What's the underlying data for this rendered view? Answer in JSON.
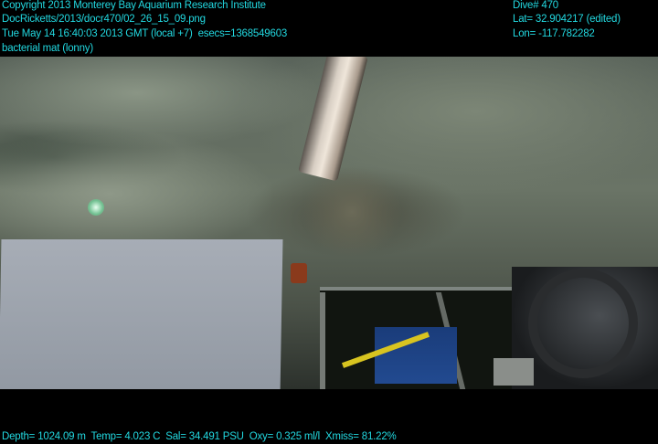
{
  "header": {
    "copyright": "Copyright 2013 Monterey Bay Aquarium Research Institute",
    "file_path": "DocRicketts/2013/docr470/02_26_15_09.png",
    "timestamp": "Tue May 14 16:40:03 2013 GMT (local +7)  esecs=1368549603",
    "annotation": "bacterial mat (lonny)",
    "dive": "Dive# 470",
    "lat": "Lat= 32.904217 (edited)",
    "lon": "Lon= -117.782282"
  },
  "footer": {
    "sensors": "Depth= 1024.09 m  Temp= 4.023 C  Sal= 34.491 PSU  Oxy= 0.325 ml/l  Xmiss= 81.22%"
  },
  "colors": {
    "overlay_text": "#22d8e0"
  }
}
